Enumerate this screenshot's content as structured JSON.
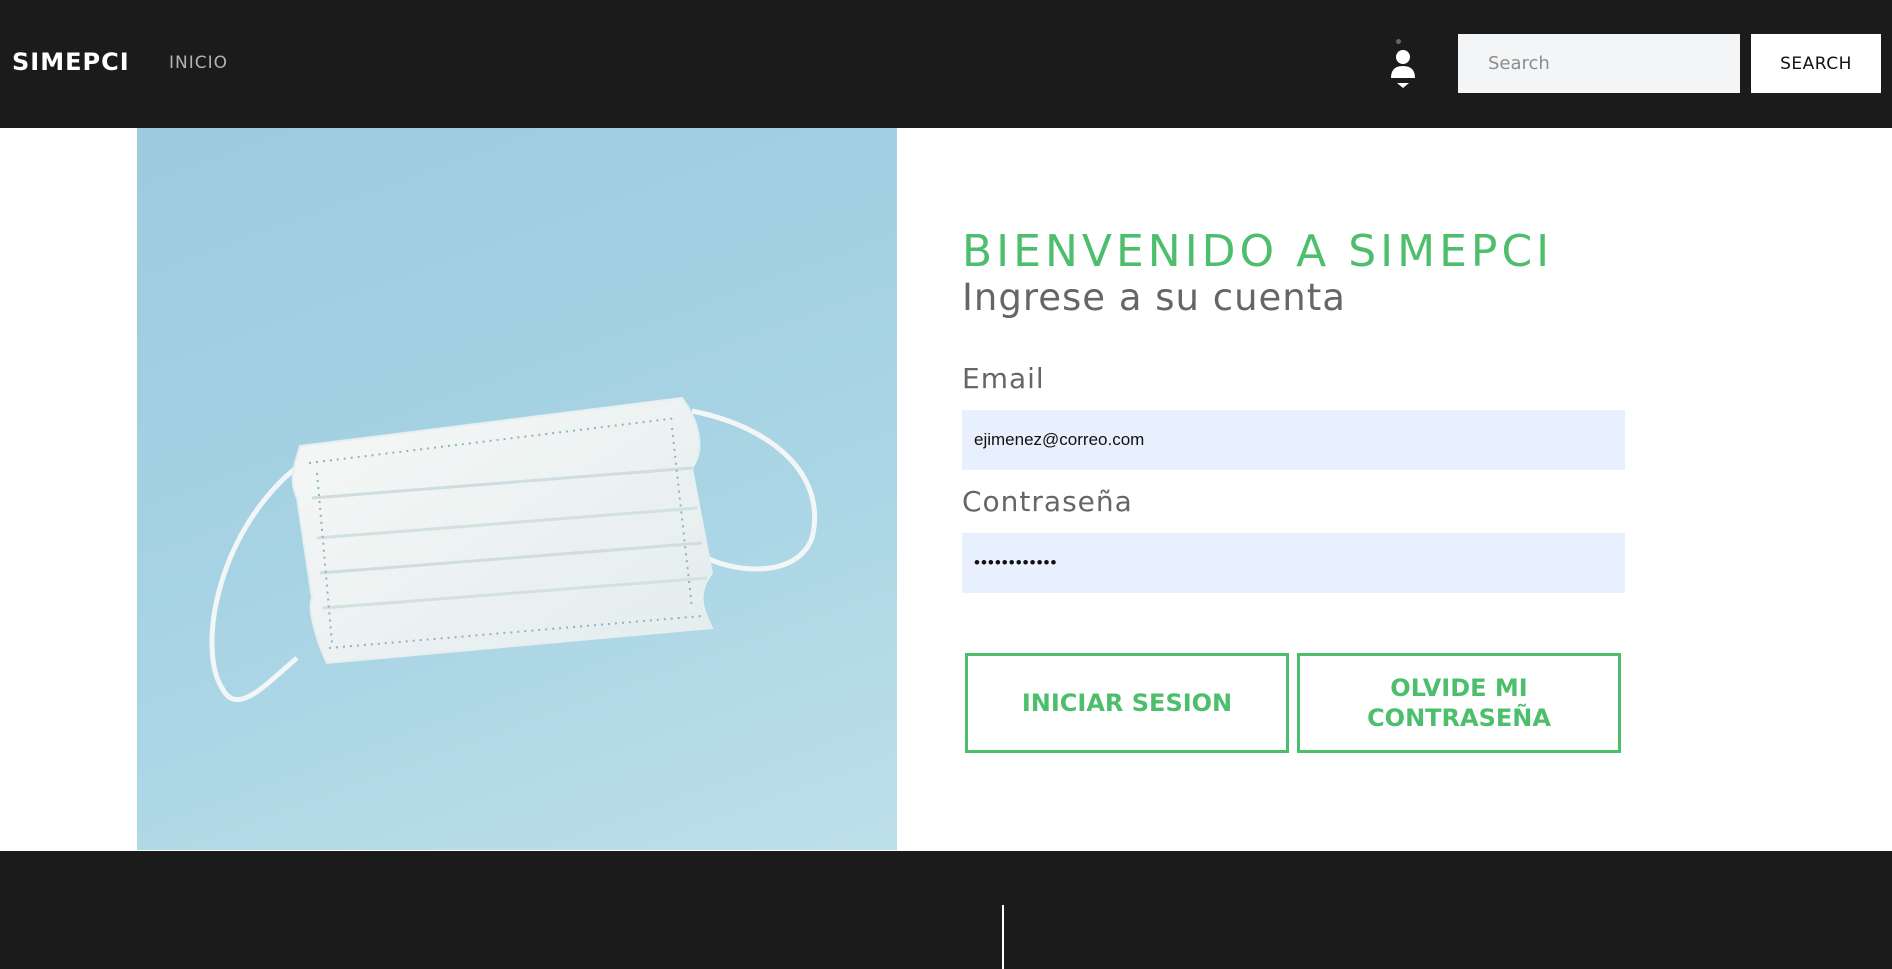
{
  "header": {
    "brand": "SIMEPCI",
    "nav": {
      "inicio": "INICIO"
    },
    "search": {
      "placeholder": "Search",
      "value": "",
      "button_label": "SEARCH"
    },
    "user_icon": "user-icon"
  },
  "hero": {
    "image_desc_icon": "surgical-mask-image"
  },
  "login": {
    "title": "BIENVENIDO A SIMEPCI",
    "subtitle": "Ingrese a su cuenta",
    "email_label": "Email",
    "email_value": "ejimenez@correo.com",
    "password_label": "Contraseña",
    "password_value": "••••••••••••",
    "login_button": "INICIAR SESION",
    "forgot_button": "OLVIDE MI CONTRASEÑA"
  },
  "colors": {
    "accent": "#4dbf6c",
    "topbar": "#1b1b1b",
    "field_bg": "#e8f0fe",
    "image_bg": "#a8d4e4"
  }
}
